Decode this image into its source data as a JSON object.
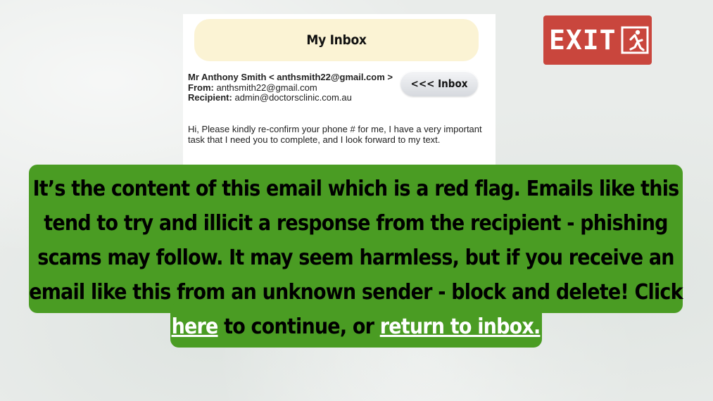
{
  "inbox": {
    "title": "My Inbox",
    "back_button": "<<< Inbox"
  },
  "email": {
    "sender_line": "Mr Anthony Smith < anthsmith22@gmail.com >",
    "from_label": "From:",
    "from_value": "anthsmith22@gmail.com",
    "recipient_label": "Recipient:",
    "recipient_value": "admin@doctorsclinic.com.au",
    "body": "Hi, Please kindly re-confirm your phone # for me, I have a very important task that I need you to complete, and I look forward to my text."
  },
  "exit": {
    "label": "EXIT",
    "icon": "running-man-exit-icon",
    "color": "#c9463d"
  },
  "message": {
    "text_part1": "It’s the content of this email which is a red flag. Emails like this tend to try and illicit a response from the recipient - phishing scams may follow. It may seem harmless, but if you receive an email like this from an unknown sender - block and delete! Click ",
    "link_here": "here",
    "text_part2": " to continue, or ",
    "link_return": "return to inbox.",
    "background_color": "#4a9c23"
  }
}
